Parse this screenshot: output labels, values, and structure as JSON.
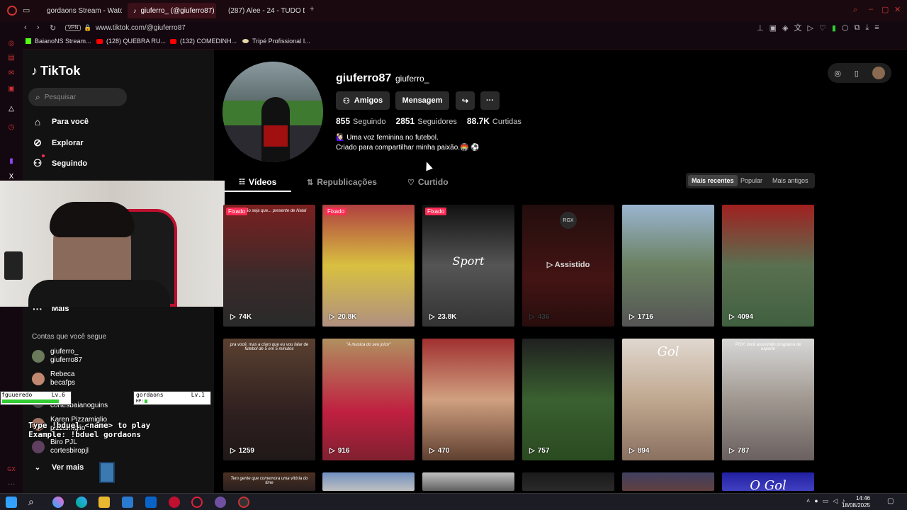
{
  "browser": {
    "tabs": [
      {
        "label": "gordaons Stream - Watch",
        "icon": "kick-icon",
        "color": "#53fc18"
      },
      {
        "label": "giuferro_ (@giuferro87) |",
        "icon": "tiktok-icon",
        "color": "#ffffff",
        "active": true
      },
      {
        "label": "(287) Alee - 24 - TUDO D",
        "icon": "youtube-icon",
        "color": "#ff0000"
      }
    ],
    "vpn": "VPN",
    "url": "www.tiktok.com/@giuferro87",
    "bookmarks": [
      {
        "label": "BaianoNS Stream...",
        "color": "#53fc18"
      },
      {
        "label": "(128) QUEBRA RU...",
        "color": "#ff0000"
      },
      {
        "label": "(132) COMEDINH...",
        "color": "#ff0000"
      },
      {
        "label": "Tripé Profissional I...",
        "color": "#e8d9a8"
      }
    ]
  },
  "tiktok": {
    "brand": "TikTok",
    "search_placeholder": "Pesquisar",
    "nav": [
      {
        "label": "Para você",
        "icon": "home-icon"
      },
      {
        "label": "Explorar",
        "icon": "compass-icon"
      },
      {
        "label": "Seguindo",
        "icon": "following-icon"
      }
    ],
    "more_label": "Mais",
    "following_section": "Contas que você segue",
    "accounts": [
      {
        "name": "giuferro_",
        "handle": "giuferro87",
        "color": "#6a7a5a"
      },
      {
        "name": "Rebeca",
        "handle": "becafps",
        "color": "#c08870"
      },
      {
        "name": "INS",
        "handle": "cortesbaianoguins",
        "color": "#444"
      },
      {
        "name": "Karen Pizzamiglio",
        "handle": "pizzamiglio",
        "color": "#a07060"
      },
      {
        "name": "Biro PJL",
        "handle": "cortesbiropjl",
        "color": "#604060"
      }
    ],
    "see_more": "Ver mais"
  },
  "overlay": {
    "duel_left_name": "fguueredo",
    "duel_left_level": "Lv.6",
    "duel_right_name": "gordaons",
    "duel_right_level": "Lv.1",
    "hp_label": "HP:",
    "line1": "Type !bduel <name> to play",
    "line2": "Example: !bduel gordaons"
  },
  "profile": {
    "username": "giuferro87",
    "nickname": "giuferro_",
    "buttons": {
      "friends": "Amigos",
      "message": "Mensagem"
    },
    "stats": [
      {
        "value": "855",
        "label": "Seguindo"
      },
      {
        "value": "2851",
        "label": "Seguidores"
      },
      {
        "value": "88.7K",
        "label": "Curtidas"
      }
    ],
    "bio_line1": "🙋🏻‍♀️ Uma voz feminina no futebol.",
    "bio_line2": "Criado para compartilhar minha paixão.🏟️ ⚽"
  },
  "tabs": [
    {
      "label": "Vídeos",
      "icon": "grid-icon",
      "active": true
    },
    {
      "label": "Republicações",
      "icon": "repost-icon"
    },
    {
      "label": "Curtido",
      "icon": "heart-icon"
    }
  ],
  "sort": [
    "Mais recentes",
    "Popular",
    "Mais antigos"
  ],
  "pinned_label": "Fixado",
  "watched_label": "Assistido",
  "videos": [
    {
      "views": "74K",
      "pinned": true,
      "bg": "linear-gradient(180deg,#7a2020,#3a2a2a 60%,#2a2a2a)",
      "caption": "essa mão seja que... presente de Natal"
    },
    {
      "views": "20.8K",
      "pinned": true,
      "bg": "linear-gradient(180deg,#b04040,#d8c040 50%,#b09080)",
      "caption": ""
    },
    {
      "views": "23.8K",
      "pinned": true,
      "bg": "linear-gradient(180deg,#111,#555 50%,#333)",
      "caption": "Sport"
    },
    {
      "views": "436",
      "watched": true,
      "badge": "RGX",
      "bg": "linear-gradient(180deg,#2a1010,#501818 60%,#301010)",
      "caption": ""
    },
    {
      "views": "1716",
      "bg": "linear-gradient(180deg,#9ab4d0,#6a8060 50%,#555)",
      "caption": ""
    },
    {
      "views": "4094",
      "bg": "linear-gradient(180deg,#a02020,#5a7050 50%,#406040)",
      "caption": ""
    },
    {
      "views": "1259",
      "bg": "linear-gradient(180deg,#5a4030,#302020 60%,#201818)",
      "caption": "pra você, mas a claro que eu vou falar de futebol de 5 em 5 minutos"
    },
    {
      "views": "916",
      "bg": "linear-gradient(180deg,#b09060,#c02040 60%,#802030)",
      "caption": "\"A musica do seu joico\""
    },
    {
      "views": "470",
      "bg": "linear-gradient(180deg,#a03030,#d0a080 50%,#604030)",
      "caption": ""
    },
    {
      "views": "757",
      "bg": "linear-gradient(180deg,#202020,#3a6030 50%,#2a4a20)",
      "caption": ""
    },
    {
      "views": "894",
      "bg": "linear-gradient(180deg,#e0d8d0,#c0a890 50%,#8a7060)",
      "caption": "Gol"
    },
    {
      "views": "787",
      "bg": "linear-gradient(180deg,#d8d8d8,#a09890 50%,#6a6060)",
      "caption": "POV: você assistindo programa de esporte"
    },
    {
      "views": "",
      "bg": "linear-gradient(180deg,#4a3020,#2a2020)",
      "caption": "Tem gente que comemora uma vitória do time"
    },
    {
      "views": "",
      "bg": "linear-gradient(180deg,#7090c0,#c0c0c0)",
      "caption": ""
    },
    {
      "views": "",
      "bg": "linear-gradient(180deg,#c0c0c0,#606060)",
      "caption": ""
    },
    {
      "views": "",
      "bg": "linear-gradient(180deg,#1a1a1a,#2a2a2a)",
      "caption": ""
    },
    {
      "views": "",
      "bg": "linear-gradient(180deg,#404060,#604040)",
      "caption": ""
    },
    {
      "views": "",
      "bg": "linear-gradient(180deg,#2020a0,#4040c0)",
      "caption": "O Gol"
    }
  ],
  "taskbar": {
    "time": "14:46",
    "date": "18/08/2025"
  }
}
